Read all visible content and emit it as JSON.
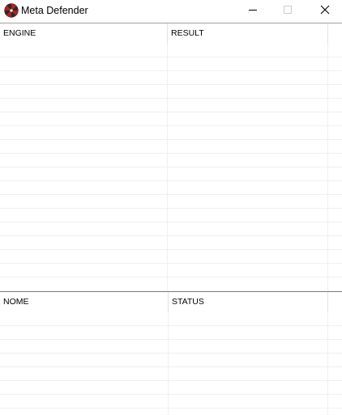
{
  "window": {
    "title": "Meta Defender",
    "icon": "umbrella-logo-icon",
    "controls": {
      "minimize": "minimize-icon",
      "maximize": "maximize-icon",
      "close": "close-icon"
    }
  },
  "engines_grid": {
    "columns": [
      "ENGINE",
      "RESULT"
    ],
    "rows": [
      [
        "",
        ""
      ],
      [
        "",
        ""
      ],
      [
        "",
        ""
      ],
      [
        "",
        ""
      ],
      [
        "",
        ""
      ],
      [
        "",
        ""
      ],
      [
        "",
        ""
      ],
      [
        "",
        ""
      ],
      [
        "",
        ""
      ],
      [
        "",
        ""
      ],
      [
        "",
        ""
      ],
      [
        "",
        ""
      ],
      [
        "",
        ""
      ],
      [
        "",
        ""
      ],
      [
        "",
        ""
      ],
      [
        "",
        ""
      ],
      [
        "",
        ""
      ],
      [
        "",
        ""
      ]
    ]
  },
  "status_grid": {
    "columns": [
      "NOME",
      "STATUS"
    ],
    "rows": [
      [
        "",
        ""
      ],
      [
        "",
        ""
      ],
      [
        "",
        ""
      ],
      [
        "",
        ""
      ],
      [
        "",
        ""
      ],
      [
        "",
        ""
      ],
      [
        "",
        ""
      ]
    ]
  }
}
